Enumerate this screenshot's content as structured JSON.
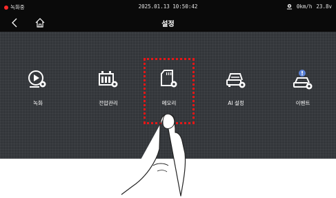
{
  "status": {
    "recording_label": "녹화중",
    "datetime": "2025.01.13 10:50:42",
    "speed": "0km/h",
    "voltage": "23.8v"
  },
  "header": {
    "title": "설정",
    "back_icon": "chevron-left-icon",
    "home_icon": "home-icon"
  },
  "menu": {
    "items": [
      {
        "label": "녹화",
        "icon": "record-settings-icon"
      },
      {
        "label": "전압관리",
        "icon": "battery-settings-icon"
      },
      {
        "label": "메모리",
        "icon": "memory-card-settings-icon"
      },
      {
        "label": "AI 설정",
        "icon": "ai-car-settings-icon"
      },
      {
        "label": "이벤트",
        "icon": "event-car-settings-icon"
      }
    ],
    "selected_index": 2
  },
  "colors": {
    "highlight": "#e81616",
    "record_dot": "#ff2a2a",
    "background": "#33363a",
    "bar": "#0a0a0a"
  }
}
